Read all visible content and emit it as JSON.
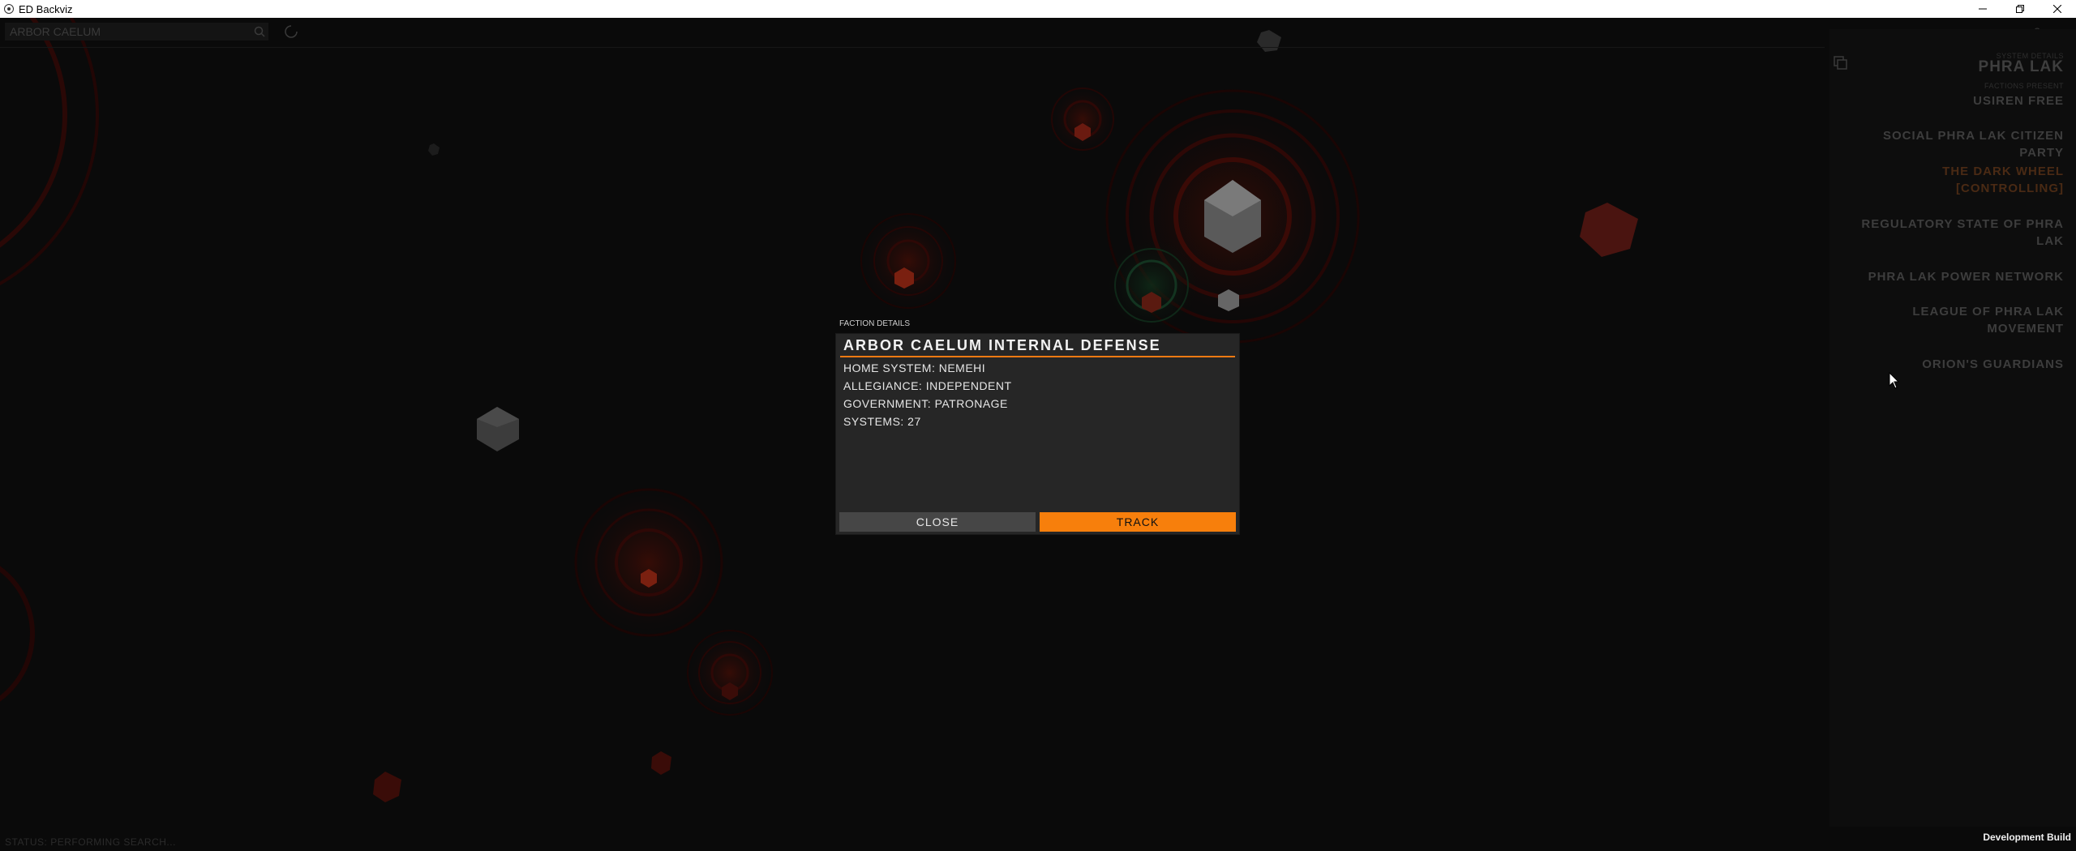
{
  "window": {
    "title": "ED Backviz",
    "minimize_icon": "minimize-icon",
    "restore_icon": "restore-icon",
    "close_icon": "close-icon"
  },
  "toolbar": {
    "search_value": "ARBOR CAELUM",
    "search_icon": "search-icon",
    "spinner_icon": "loading-spinner-icon",
    "help_label": "?"
  },
  "system_panel": {
    "caption": "SYSTEM DETAILS",
    "system_name": "PHRA LAK",
    "factions_caption": "FACTIONS PRESENT",
    "factions": [
      {
        "label": "USIREN FREE",
        "controlling": false
      },
      {
        "label": "SOCIAL PHRA LAK CITIZEN PARTY",
        "controlling": false
      },
      {
        "label": "THE DARK WHEEL [CONTROLLING]",
        "controlling": true
      },
      {
        "label": "REGULATORY STATE OF PHRA LAK",
        "controlling": false
      },
      {
        "label": "PHRA LAK POWER NETWORK",
        "controlling": false
      },
      {
        "label": "LEAGUE OF PHRA LAK MOVEMENT",
        "controlling": false
      },
      {
        "label": "ORION'S GUARDIANS",
        "controlling": false
      }
    ]
  },
  "faction_modal": {
    "caption": "FACTION DETAILS",
    "title": "ARBOR CAELUM INTERNAL DEFENSE",
    "home_system": "HOME SYSTEM: NEMEHI",
    "allegiance": "ALLEGIANCE: INDEPENDENT",
    "government": "GOVERNMENT: PATRONAGE",
    "systems": "SYSTEMS: 27",
    "close_label": "CLOSE",
    "track_label": "TRACK"
  },
  "status": {
    "text": "STATUS: PERFORMING SEARCH..."
  },
  "build_label": "Development Build",
  "colors": {
    "accent": "#f77f0c",
    "background": "#000000",
    "modal_bg": "#262626"
  }
}
